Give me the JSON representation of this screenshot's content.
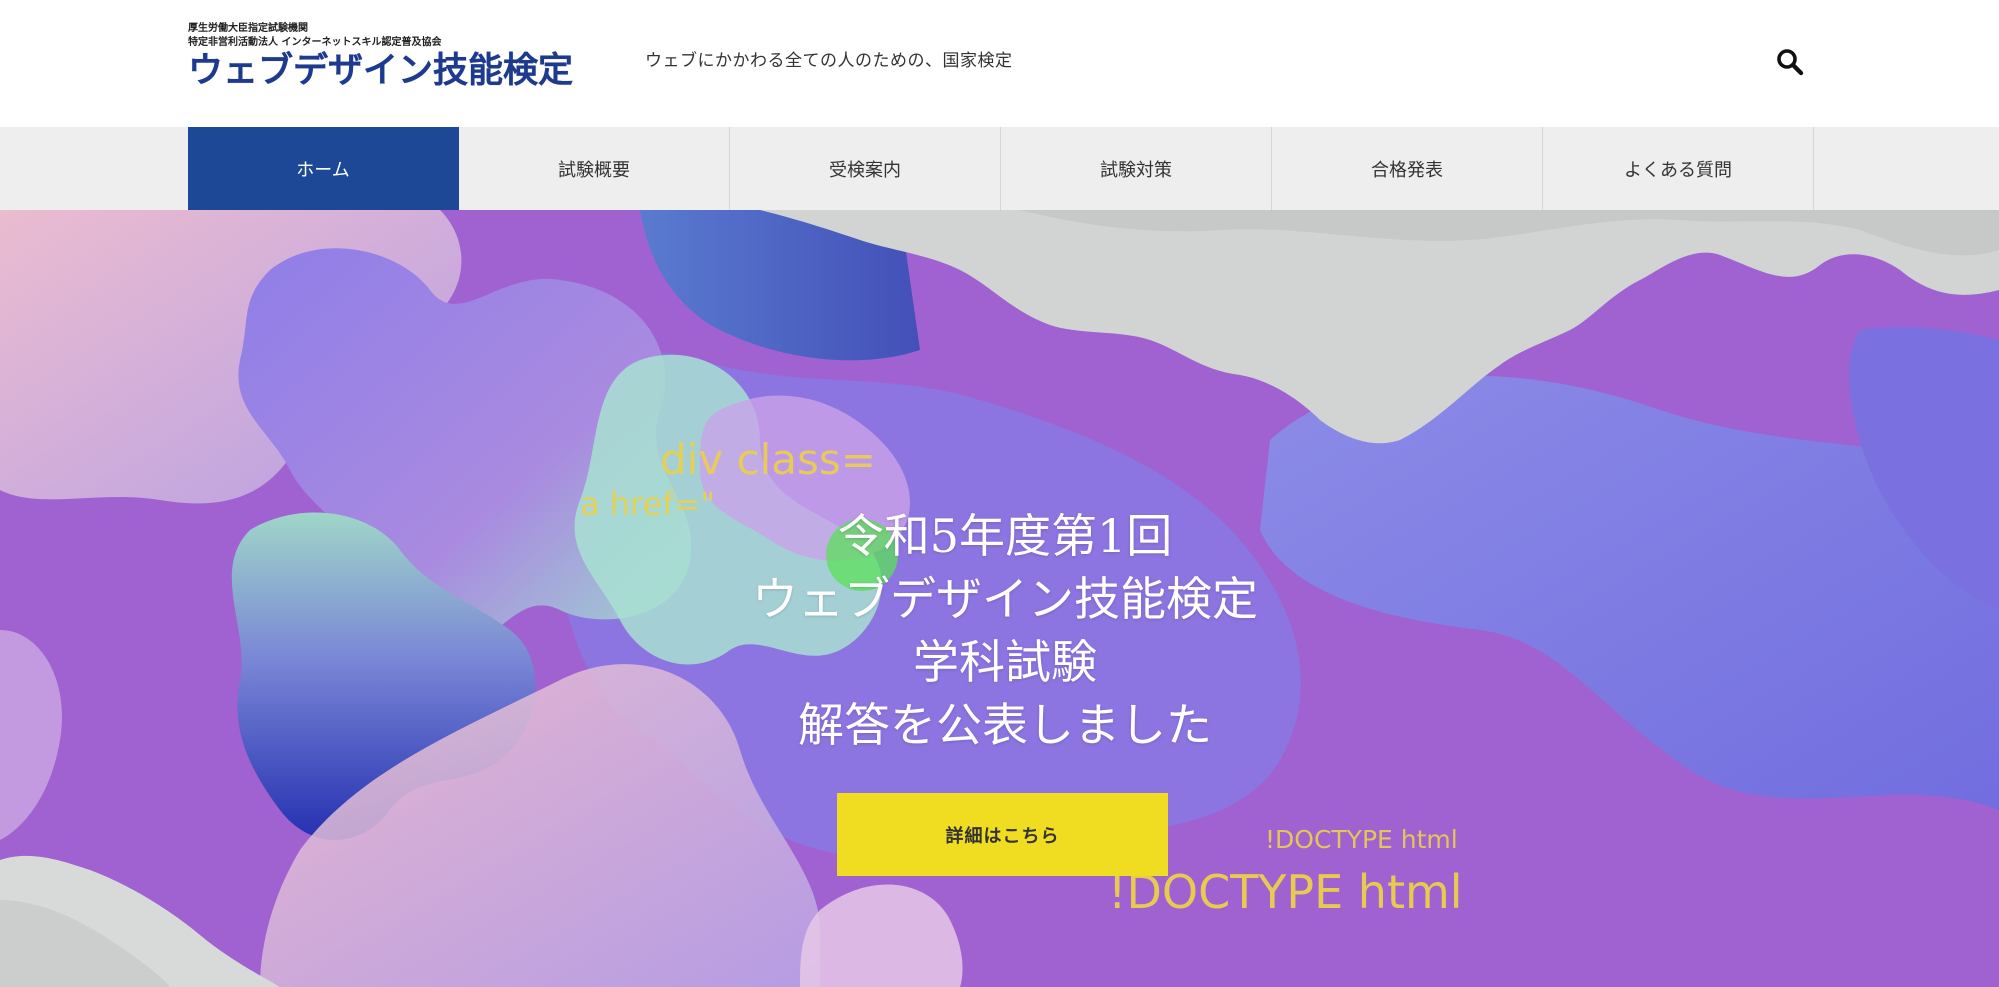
{
  "header": {
    "org_line1": "厚生労働大臣指定試験機関",
    "org_line2": "特定非営利活動法人 インターネットスキル認定普及協会",
    "logo_text": "ウェブデザイン技能検定",
    "tagline": "ウェブにかかわる全ての人のための、国家検定",
    "search_icon": "search-icon"
  },
  "nav": {
    "items": [
      {
        "label": "ホーム",
        "active": true
      },
      {
        "label": "試験概要"
      },
      {
        "label": "受検案内"
      },
      {
        "label": "試験対策"
      },
      {
        "label": "合格発表"
      },
      {
        "label": "よくある質問"
      }
    ]
  },
  "hero": {
    "lines": [
      "令和5年度第1回",
      "ウェブデザイン技能検定",
      "学科試験",
      "解答を公表しました"
    ],
    "cta_label": "詳細はこちら",
    "code_snippets": [
      "div class=",
      "a href=\"",
      "!DOCTYPE html",
      "!DOCTYPE html"
    ]
  },
  "colors": {
    "brand_blue": "#1c4896",
    "logo_blue": "#1e3a8e",
    "cta_yellow": "#f0dd22",
    "hero_purple": "#a062d1",
    "nav_bg": "#eeeeee"
  }
}
